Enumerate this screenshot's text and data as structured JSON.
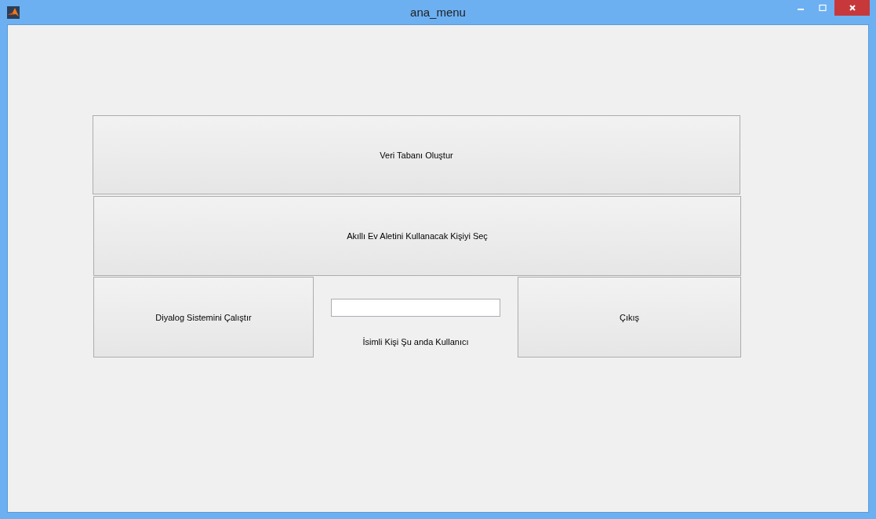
{
  "window": {
    "title": "ana_menu"
  },
  "buttons": [
    {
      "label": "Veri Tabanı Oluştur"
    },
    {
      "label": "Akıllı Ev Aletini Kullanacak Kişiyi Seç"
    }
  ],
  "bottom_row": {
    "left_button": {
      "label": "Diyalog Sistemini Çalıştır"
    },
    "caption": "İsimli Kişi Şu anda Kullanıcı",
    "right_button": {
      "label": "Çıkış"
    }
  }
}
